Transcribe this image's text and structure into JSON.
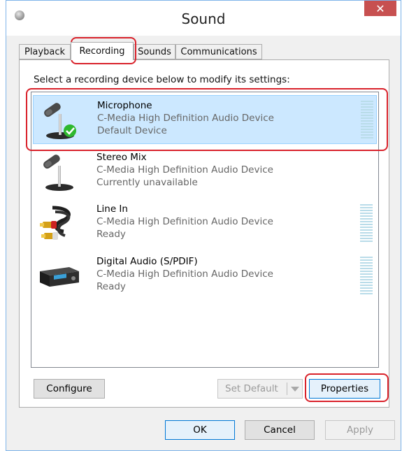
{
  "window": {
    "title": "Sound",
    "close_symbol": "✕"
  },
  "tabs": [
    {
      "label": "Playback"
    },
    {
      "label": "Recording"
    },
    {
      "label": "Sounds"
    },
    {
      "label": "Communications"
    }
  ],
  "instruction": "Select a recording device below to modify its settings:",
  "devices": [
    {
      "name": "Microphone",
      "driver": "C-Media High Definition Audio Device",
      "status": "Default Device",
      "icon": "microphone-icon",
      "selected": true,
      "default_check": true,
      "level_meter": true
    },
    {
      "name": "Stereo Mix",
      "driver": "C-Media High Definition Audio Device",
      "status": "Currently unavailable",
      "icon": "microphone-icon",
      "selected": false,
      "level_meter": false
    },
    {
      "name": "Line In",
      "driver": "C-Media High Definition Audio Device",
      "status": "Ready",
      "icon": "rca-cable-icon",
      "selected": false,
      "level_meter": true
    },
    {
      "name": "Digital Audio (S/PDIF)",
      "driver": "C-Media High Definition Audio Device",
      "status": "Ready",
      "icon": "digital-audio-device-icon",
      "selected": false,
      "level_meter": true
    }
  ],
  "buttons": {
    "configure": "Configure",
    "set_default": "Set Default",
    "properties": "Properties",
    "ok": "OK",
    "cancel": "Cancel",
    "apply": "Apply"
  },
  "colors": {
    "selection_bg": "#cce8ff",
    "close_button": "#c75050",
    "highlight": "#d9222b",
    "default_check": "#2eb82e"
  }
}
